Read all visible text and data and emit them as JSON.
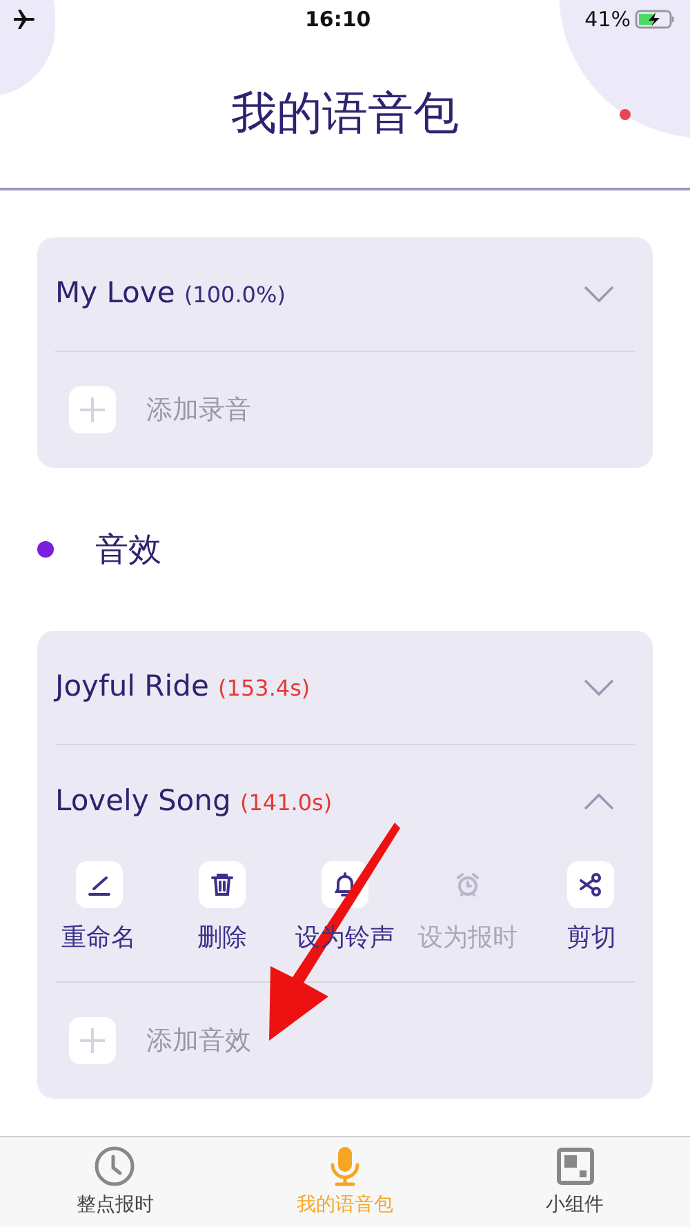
{
  "status_bar": {
    "time": "16:10",
    "battery": "41%"
  },
  "title": "我的语音包",
  "packs": [
    {
      "rows": [
        {
          "name": "My Love",
          "detail": "(100.0%)",
          "color": "#3b2a7a",
          "expanded": false
        }
      ],
      "add_label": "添加录音"
    }
  ],
  "section": {
    "title": "音效"
  },
  "effects": {
    "rows": [
      {
        "name": "Joyful Ride",
        "detail": "(153.4s)",
        "color": "#e53935",
        "expanded": false
      },
      {
        "name": "Lovely Song",
        "detail": "(141.0s)",
        "color": "#e53935",
        "expanded": true,
        "actions": [
          {
            "kind": "rename",
            "label": "重命名",
            "disabled": false
          },
          {
            "kind": "delete",
            "label": "删除",
            "disabled": false
          },
          {
            "kind": "ringtone",
            "label": "设为铃声",
            "disabled": false
          },
          {
            "kind": "alarm",
            "label": "设为报时",
            "disabled": true
          },
          {
            "kind": "cut",
            "label": "剪切",
            "disabled": false
          }
        ]
      }
    ],
    "add_label": "添加音效"
  },
  "tabs": [
    {
      "kind": "clock",
      "label": "整点报时",
      "selected": false
    },
    {
      "kind": "mic",
      "label": "我的语音包",
      "selected": true
    },
    {
      "kind": "widget",
      "label": "小组件",
      "selected": false
    }
  ]
}
